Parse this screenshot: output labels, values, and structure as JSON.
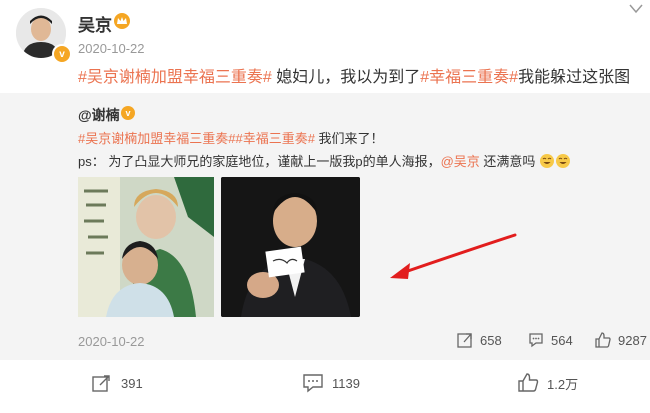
{
  "post": {
    "username": "吴京",
    "time": "2020-10-22",
    "text": {
      "topic1": "#吴京谢楠加盟幸福三重奏#",
      "mid": " 媳妇儿，我以为到了",
      "topic2": "#幸福三重奏#",
      "end": "我能躲过这张图"
    }
  },
  "repost": {
    "author": "@谢楠",
    "line1": {
      "topic1": "#吴京谢楠加盟幸福三重奏#",
      "topic2": "#幸福三重奏#",
      "end": " 我们来了！"
    },
    "line2": {
      "start": "ps：  为了凸显大师兄的家庭地位，谨献上一版我p的单人海报，",
      "mention": "@吴京",
      "end": " 还满意吗"
    },
    "date": "2020-10-22",
    "stats": {
      "repost": "658",
      "comment": "564",
      "like": "9287"
    }
  },
  "footer": {
    "repost": "391",
    "comment": "1139",
    "like": "1.2万"
  },
  "icons": [
    "crown-vip-icon",
    "chevron-down-icon",
    "verified-badge-icon",
    "share-icon",
    "comment-icon",
    "like-icon",
    "laugh-emoji-icon"
  ],
  "colors": {
    "topic": "#eb7350",
    "badge": "#f5a623",
    "repost_bg": "#f4f4f4"
  }
}
